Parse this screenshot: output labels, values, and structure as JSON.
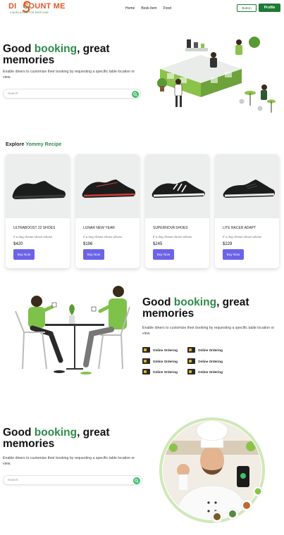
{
  "brand": {
    "name_pre": "DI",
    "name_post": "COUNT ME",
    "tagline": "A WORLD DEAL FOR EVERYONE",
    "accent": "#1e7a36"
  },
  "nav": {
    "items": [
      "Home",
      "Book item",
      "Food"
    ]
  },
  "header": {
    "button_label": "Button",
    "profile_label": "Profile"
  },
  "hero": {
    "title_pre": "Good ",
    "title_accent": "booking",
    "title_post": ", great",
    "title_line2": "memories",
    "description": "Enable diners to customize their booking by requesting a specific table location or view.",
    "search_placeholder": "Search"
  },
  "explore": {
    "title_pre": "Explore ",
    "title_accent": "Yommy Recipe",
    "cards": [
      {
        "name": "ULTRABOOST 22 SHOES",
        "desc": "If a dog chews shoes whose",
        "price": "$420",
        "button": "Buy Now",
        "icon": "black-sneaker-image"
      },
      {
        "name": "LUNAR NEW YEAR",
        "desc": "If a dog chews shoes whose",
        "price": "$196",
        "button": "Buy Now",
        "icon": "black-red-sneaker-image"
      },
      {
        "name": "SUPERNOVA SHOES",
        "desc": "If a dog chews shoes whose",
        "price": "$245",
        "button": "Buy Now",
        "icon": "black-white-stripe-sneaker-image"
      },
      {
        "name": "LITE RACER ADAPT",
        "desc": "If a dog chews shoes whose",
        "price": "$229",
        "button": "Buy Now",
        "icon": "slip-on-sneaker-image"
      }
    ]
  },
  "section2": {
    "title_pre": "Good ",
    "title_accent": "booking",
    "title_post": ", great",
    "title_line2": "memories",
    "description": "Enable diners to customize their booking by requesting a specific table location or view.",
    "features": [
      "Online Ordering",
      "Online Ordering",
      "Online Ordering",
      "Online Ordering",
      "Online Ordering",
      "Online Ordering"
    ]
  },
  "section3": {
    "title_pre": "Good ",
    "title_accent": "booking",
    "title_post": ", great",
    "title_line2": "memories",
    "description": "Enable diners to customize their booking by requesting a specific table location or view.",
    "search_placeholder": "Search"
  }
}
